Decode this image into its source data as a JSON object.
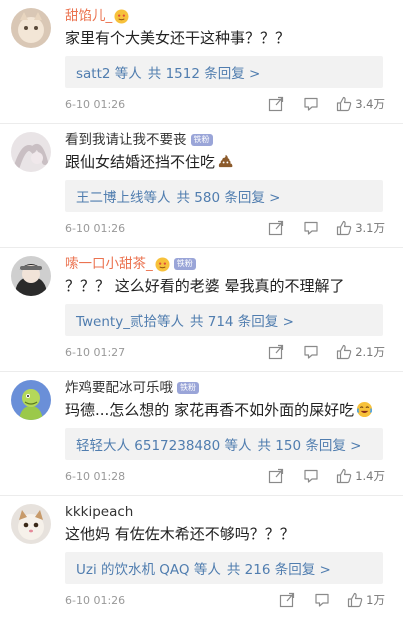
{
  "comments": [
    {
      "username": "甜馅儿_",
      "name_color": "orange",
      "fan_badge": "",
      "text": "家里有个大美女还干这种事？？？",
      "reply_users": "satt2 等人",
      "reply_count": "共 1512 条回复 >",
      "time": "6-10 01:26",
      "likes": "3.4万"
    },
    {
      "username": "看到我请让我不要丧",
      "name_color": "gray",
      "fan_badge": "铁粉",
      "text": "跟仙女结婚还挡不住吃",
      "reply_users": "王二博上线等人",
      "reply_count": "共 580 条回复 >",
      "time": "6-10 01:26",
      "likes": "3.1万"
    },
    {
      "username": "嗦一口小甜茶_",
      "name_color": "orange",
      "fan_badge": "铁粉",
      "text": "？？？ 这么好看的老婆  晕我真的不理解了",
      "reply_users": "Twenty_贰拾等人",
      "reply_count": "共 714 条回复 >",
      "time": "6-10 01:27",
      "likes": "2.1万"
    },
    {
      "username": "炸鸡要配冰可乐哦",
      "name_color": "gray",
      "fan_badge": "铁粉",
      "text": "玛德...怎么想的 家花再香不如外面的屎好吃",
      "reply_users": "轻轻大人 6517238480 等人",
      "reply_count": "共 150 条回复 >",
      "time": "6-10 01:28",
      "likes": "1.4万"
    },
    {
      "username": "kkkipeach",
      "name_color": "gray",
      "fan_badge": "",
      "text": "这他妈 有佐佐木希还不够吗？？？",
      "reply_users": "Uzi 的饮水机 QAQ 等人",
      "reply_count": "共 216 条回复 >",
      "time": "6-10 01:26",
      "likes": "1万"
    }
  ],
  "icons": {
    "action_icons": [
      "share-icon",
      "comment-icon",
      "like-icon"
    ],
    "emoji_row2": "poop-emoji",
    "emoji_row4": "crying-laughing-emoji"
  },
  "colors": {
    "username_orange": "#eb7350",
    "link_blue": "#507daf",
    "reply_bg": "#f2f2f2",
    "badge": "#9aa5d8"
  }
}
